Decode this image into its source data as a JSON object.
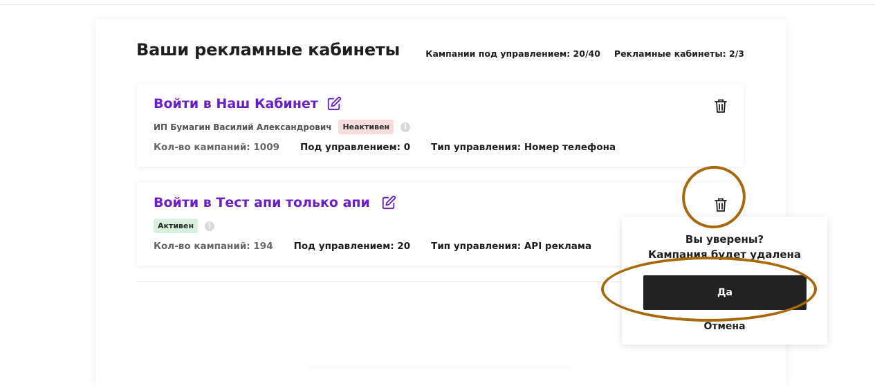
{
  "header": {
    "title": "Ваши рекламные кабинеты",
    "campaigns_under_management": "Кампании под управлением: 20/40",
    "ad_cabinets": "Рекламные кабинеты: 2/3"
  },
  "cabinets": [
    {
      "title": "Войти в Наш Кабинет",
      "owner": "ИП Бумагин Василий Александрович",
      "status": "Неактивен",
      "campaign_count": "Кол-во кампаний: 1009",
      "under_management": "Под управлением: 0",
      "management_type": "Тип управления: Номер телефона"
    },
    {
      "title": "Войти в Тест апи только апи",
      "status": "Активен",
      "campaign_count": "Кол-во кампаний: 194",
      "under_management": "Под управлением: 20",
      "management_type": "Тип управления: API реклама"
    }
  ],
  "confirm": {
    "question": "Вы уверены?",
    "message": "Кампания будет удалена",
    "yes_label": "Да",
    "cancel_label": "Отмена"
  },
  "icons": {
    "edit": "edit-icon",
    "delete": "trash-icon",
    "info": "info-icon"
  },
  "colors": {
    "title_purple": "#6b1ccb",
    "inactive_badge": "#f9dcdc",
    "active_badge": "#d9f0df",
    "primary_button": "#222222",
    "annotation": "#a8690a"
  }
}
